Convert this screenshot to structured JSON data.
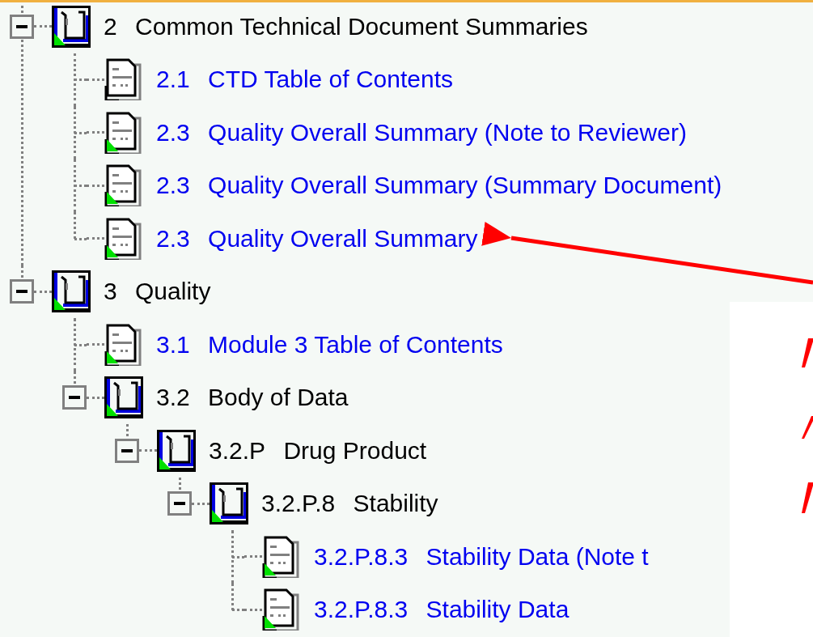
{
  "tree": [
    {
      "kind": "folder",
      "number": "2",
      "title": "Common Technical Document Summaries",
      "expanded": true,
      "marked": true,
      "children": [
        {
          "kind": "document",
          "number": "2.1",
          "title": "CTD Table of Contents",
          "marked": false
        },
        {
          "kind": "document",
          "number": "2.3",
          "title": "Quality Overall Summary (Note to Reviewer)",
          "marked": true
        },
        {
          "kind": "document",
          "number": "2.3",
          "title": "Quality Overall Summary (Summary Document)",
          "marked": true
        },
        {
          "kind": "document",
          "number": "2.3",
          "title": "Quality Overall Summary",
          "marked": true
        }
      ]
    },
    {
      "kind": "folder",
      "number": "3",
      "title": "Quality",
      "expanded": true,
      "marked": true,
      "children": [
        {
          "kind": "document",
          "number": "3.1",
          "title": "Module 3 Table of Contents",
          "marked": true
        },
        {
          "kind": "folder",
          "number": "3.2",
          "title": "Body of Data",
          "expanded": true,
          "marked": true,
          "children": [
            {
              "kind": "folder",
              "number": "3.2.P",
              "title": "Drug Product",
              "expanded": true,
              "marked": true,
              "children": [
                {
                  "kind": "folder",
                  "number": "3.2.P.8",
                  "title": "Stability",
                  "expanded": true,
                  "marked": true,
                  "children": [
                    {
                      "kind": "document",
                      "number": "3.2.P.8.3",
                      "title": "Stability Data (Note t",
                      "marked": true
                    },
                    {
                      "kind": "document",
                      "number": "3.2.P.8.3",
                      "title": "Stability Data",
                      "marked": true
                    }
                  ]
                }
              ]
            }
          ]
        }
      ]
    }
  ]
}
